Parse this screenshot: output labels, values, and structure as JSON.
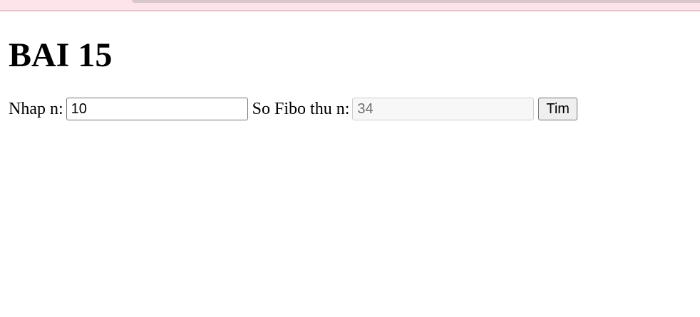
{
  "page": {
    "title": "BAI 15"
  },
  "form": {
    "input_label": "Nhap n:",
    "input_value": "10",
    "result_label": "So Fibo thu n:",
    "result_value": "34",
    "button_label": "Tim"
  }
}
